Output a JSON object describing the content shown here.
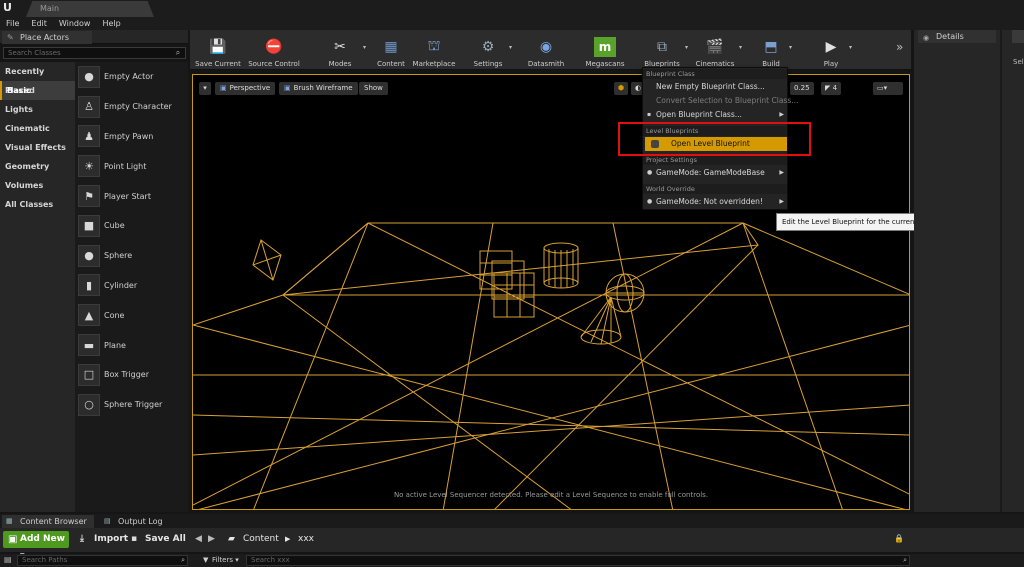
{
  "app": {
    "logo": "U",
    "tab_title": "Main"
  },
  "menu": [
    "File",
    "Edit",
    "Window",
    "Help"
  ],
  "left_panel": {
    "tab_label": "Place Actors",
    "search_placeholder": "Search Classes",
    "categories": [
      {
        "label": "Recently Placed",
        "selected": false
      },
      {
        "label": "Basic",
        "selected": true
      },
      {
        "label": "Lights",
        "selected": false
      },
      {
        "label": "Cinematic",
        "selected": false
      },
      {
        "label": "Visual Effects",
        "selected": false
      },
      {
        "label": "Geometry",
        "selected": false
      },
      {
        "label": "Volumes",
        "selected": false
      },
      {
        "label": "All Classes",
        "selected": false
      }
    ],
    "actors": [
      {
        "label": "Empty Actor",
        "icon": "sphere-icon"
      },
      {
        "label": "Empty Character",
        "icon": "character-icon"
      },
      {
        "label": "Empty Pawn",
        "icon": "pawn-icon"
      },
      {
        "label": "Point Light",
        "icon": "lightbulb-icon"
      },
      {
        "label": "Player Start",
        "icon": "flag-icon"
      },
      {
        "label": "Cube",
        "icon": "cube-icon"
      },
      {
        "label": "Sphere",
        "icon": "sphere-icon"
      },
      {
        "label": "Cylinder",
        "icon": "cylinder-icon"
      },
      {
        "label": "Cone",
        "icon": "cone-icon"
      },
      {
        "label": "Plane",
        "icon": "plane-icon"
      },
      {
        "label": "Box Trigger",
        "icon": "box-trigger-icon"
      },
      {
        "label": "Sphere Trigger",
        "icon": "sphere-trigger-icon"
      }
    ]
  },
  "toolbar": {
    "save_current": "Save Current",
    "source_control": "Source Control",
    "modes": "Modes",
    "content": "Content",
    "marketplace": "Marketplace",
    "settings": "Settings",
    "datasmith": "Datasmith",
    "megascans": "Megascans",
    "blueprints": "Blueprints",
    "cinematics": "Cinematics",
    "build": "Build",
    "play": "Play",
    "megascans_glyph": "m"
  },
  "viewport": {
    "perspective": "Perspective",
    "brush_wireframe": "Brush Wireframe",
    "show": "Show",
    "snap_value": "0.25",
    "camera_speed": "4",
    "notice": "No active Level Sequencer detected. Please edit a Level Sequence to enable full controls.",
    "wire_color": "#d9a135"
  },
  "blueprint_menu": {
    "section_class": "Blueprint Class",
    "new_empty": "New Empty Blueprint Class...",
    "convert_selection": "Convert Selection to Blueprint Class...",
    "open_class": "Open Blueprint Class...",
    "section_level": "Level Blueprints",
    "open_level": "Open Level Blueprint",
    "section_project": "Project Settings",
    "gamemode_project": "GameMode: GameModeBase",
    "section_world": "World Override",
    "gamemode_world": "GameMode: Not overridden!"
  },
  "tooltip": "Edit the Level Blueprint for the current level",
  "right_panel": {
    "details_tab": "Details",
    "select_hint": "Sele"
  },
  "bottom": {
    "content_browser_tab": "Content Browser",
    "output_log_tab": "Output Log",
    "add_new": "Add New",
    "import": "Import",
    "save_all": "Save All",
    "crumb_root": "Content",
    "crumb_folder": "xxx",
    "search_paths_placeholder": "Search Paths",
    "filters": "Filters",
    "search_assets_placeholder": "Search xxx"
  },
  "colors": {
    "accent": "#d59a00",
    "add_new_green": "#4e9a1e",
    "highlight_red": "#e01010"
  }
}
